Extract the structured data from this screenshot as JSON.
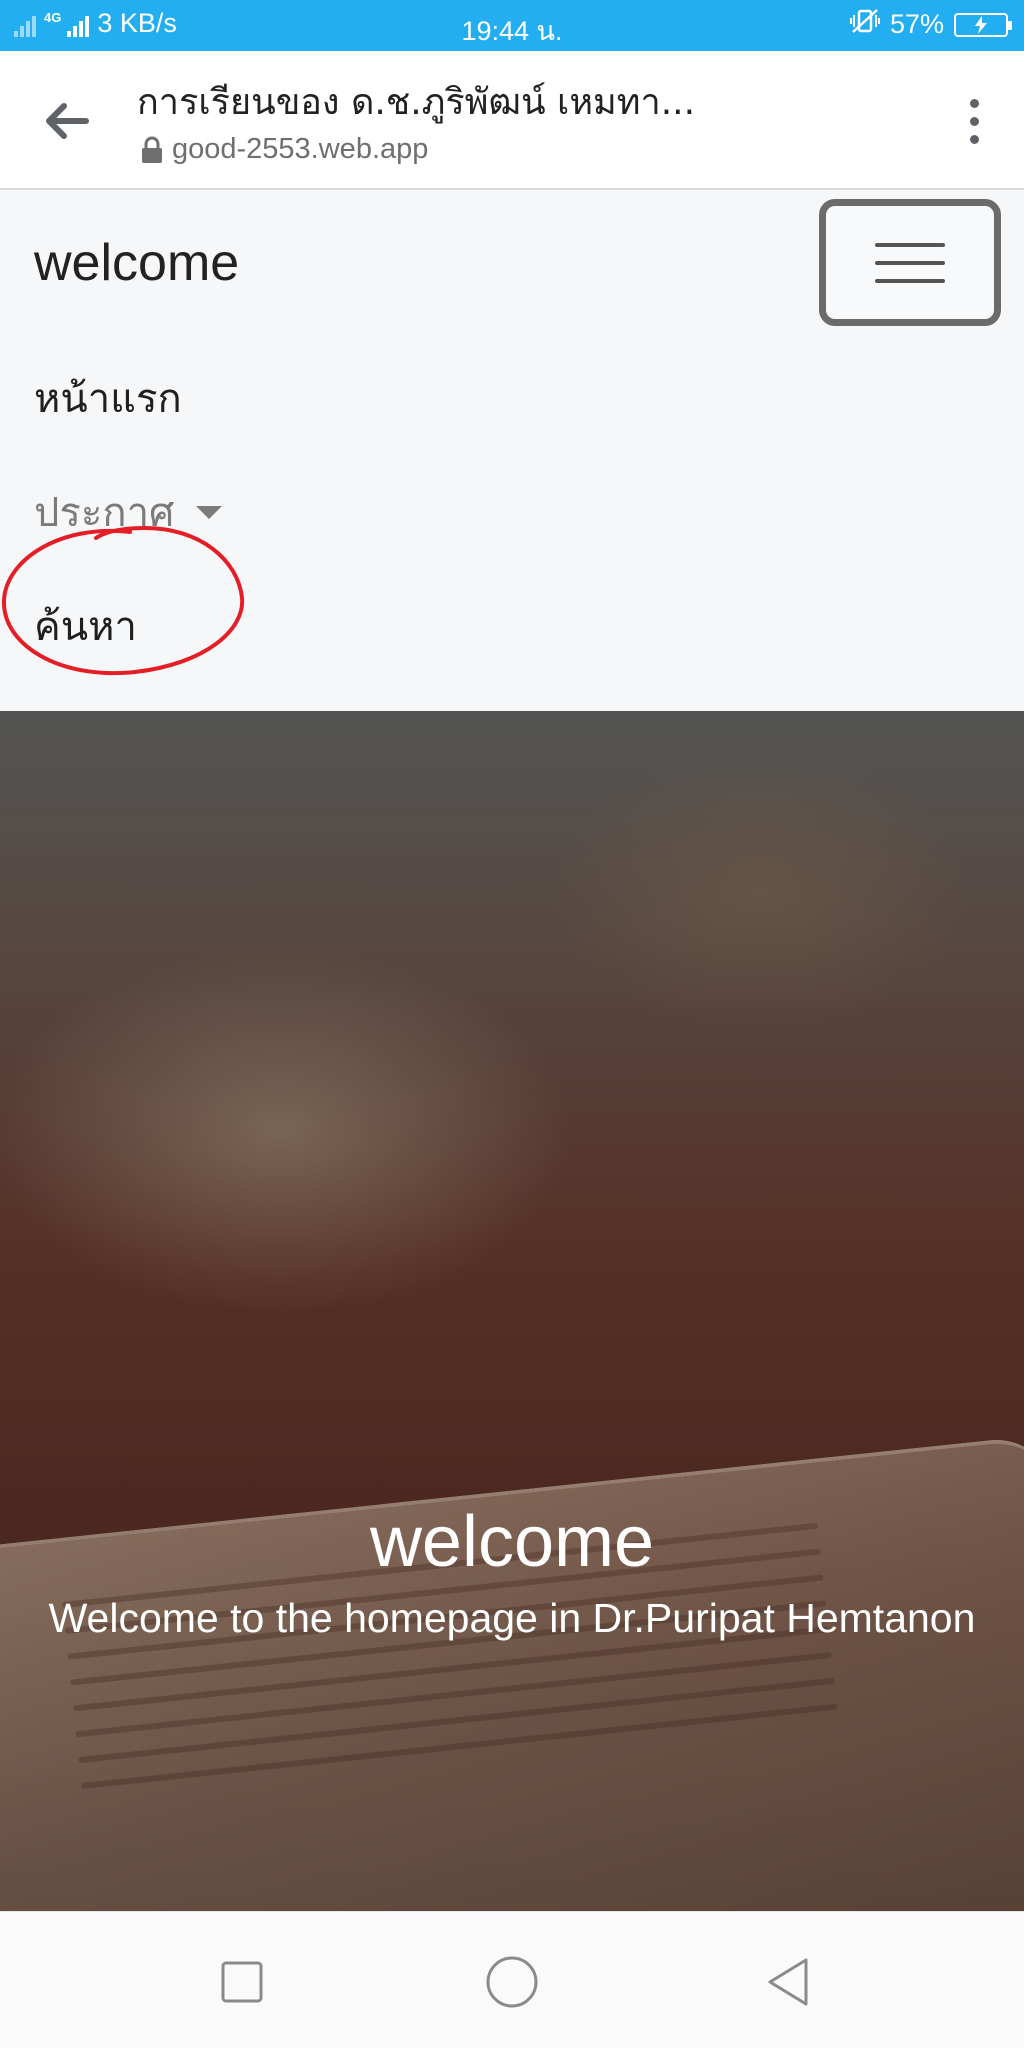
{
  "status_bar": {
    "network_type": "4G",
    "speed": "3 KB/s",
    "time": "19:44 น.",
    "battery": "57%"
  },
  "browser": {
    "title": "การเรียนของ ด.ช.ภูริพัฒน์ เหมทา...",
    "url": "good-2553.web.app"
  },
  "site": {
    "brand": "welcome",
    "nav": [
      {
        "label": "หน้าแรก"
      },
      {
        "label": "ประกาศ"
      },
      {
        "label": "ค้นหา"
      }
    ],
    "hero": {
      "title": "welcome",
      "subtitle": "Welcome to the homepage in Dr.Puripat Hemtanon"
    }
  },
  "colors": {
    "status_bar": "#22aef0",
    "navbar_bg": "#f6f7f9",
    "annotation": "#e41e26"
  },
  "icons": [
    "back-arrow-icon",
    "lock-icon",
    "more-vert-icon",
    "hamburger-icon",
    "dropdown-caret-icon",
    "recent-apps-icon",
    "home-icon",
    "back-triangle-icon"
  ]
}
